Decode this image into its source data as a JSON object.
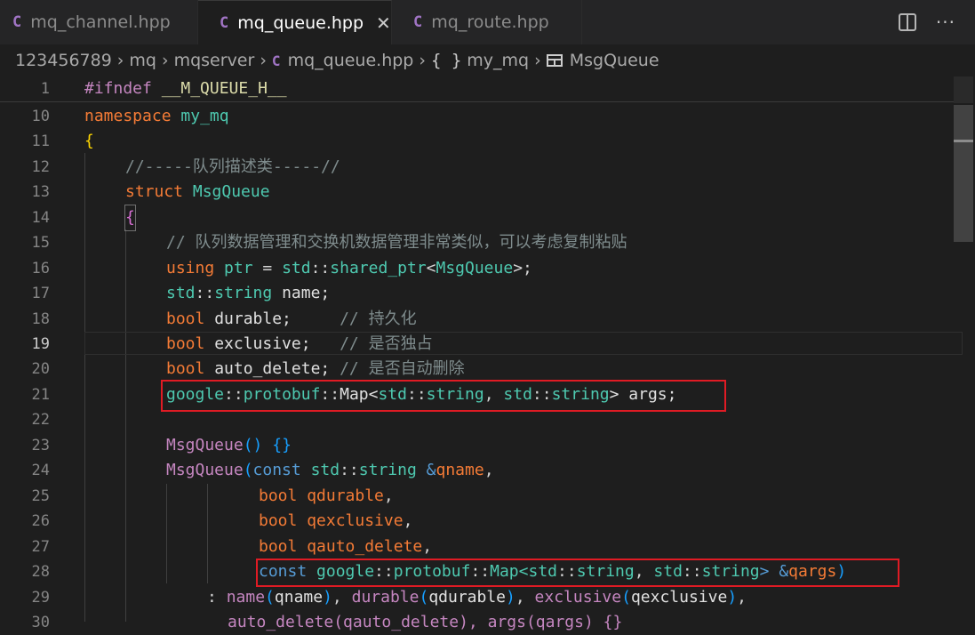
{
  "tabs": [
    {
      "label": "mq_channel.hpp",
      "icon": "C"
    },
    {
      "label": "mq_queue.hpp",
      "icon": "C",
      "close": "✕"
    },
    {
      "label": "mq_route.hpp",
      "icon": "C"
    }
  ],
  "breadcrumb": {
    "items": [
      "123456789",
      "mq",
      "mqserver",
      "mq_queue.hpp",
      "my_mq",
      "MsgQueue"
    ],
    "braces": "{ }",
    "file_icon": "C"
  },
  "editor": {
    "line_numbers": [
      "1",
      "10",
      "11",
      "12",
      "13",
      "14",
      "15",
      "16",
      "17",
      "18",
      "19",
      "20",
      "21",
      "22",
      "23",
      "24",
      "25",
      "26",
      "27",
      "28",
      "29",
      "30"
    ],
    "current_line": "19",
    "lines": {
      "l1_macro": "#ifndef",
      "l1_name": "__M_QUEUE_H__",
      "l10_kw": "namespace",
      "l10_name": "my_mq",
      "l11_brace": "{",
      "l12_comment": "//-----队列描述类-----//",
      "l13_kw": "struct",
      "l13_name": "MsgQueue",
      "l14_brace": "{",
      "l15_comment": "// 队列数据管理和交换机数据管理非常类似，可以考虑复制粘贴",
      "l16_using": "using",
      "l16_ptr": "ptr",
      "l16_eq": " = ",
      "l16_std": "std",
      "l16_sep": "::",
      "l16_shared": "shared_ptr",
      "l16_lt": "<",
      "l16_cls": "MsgQueue",
      "l16_end": ">;",
      "l17_std": "std",
      "l17_sep": "::",
      "l17_type": "string",
      "l17_rest": " name;",
      "l18_bool": "bool",
      "l18_rest": " durable;",
      "l18_comment": "// 持久化",
      "l19_bool": "bool",
      "l19_rest": " exclusive;",
      "l19_comment": "// 是否独占",
      "l20_bool": "bool",
      "l20_rest": " auto_delete;",
      "l20_comment": "// 是否自动删除",
      "l21_google": "google",
      "l21_sep1": "::",
      "l21_protobuf": "protobuf",
      "l21_sep2": "::",
      "l21_map": "Map<",
      "l21_std1": "std",
      "l21_sep3": "::",
      "l21_str1": "string",
      "l21_comma": ", ",
      "l21_std2": "std",
      "l21_sep4": "::",
      "l21_str2": "string",
      "l21_end": "> args;",
      "l23_ctor": "MsgQueue",
      "l23_par": "()",
      "l23_sp": " ",
      "l23_body": "{}",
      "l24_ctor": "MsgQueue",
      "l24_open": "(",
      "l24_const": "const",
      "l24_std": " std",
      "l24_sep": "::",
      "l24_type": "string",
      "l24_amp": " &",
      "l24_param": "qname",
      "l24_comma": ",",
      "l25_bool": "bool",
      "l25_param": " qdurable",
      "l25_comma": ",",
      "l26_bool": "bool",
      "l26_param": " qexclusive",
      "l26_comma": ",",
      "l27_bool": "bool",
      "l27_param": " qauto_delete",
      "l27_comma": ",",
      "l28_const": "const",
      "l28_google": " google",
      "l28_sep1": "::",
      "l28_protobuf": "protobuf",
      "l28_sep2": "::",
      "l28_map": "Map<",
      "l28_std1": "std",
      "l28_sep3": "::",
      "l28_str1": "string",
      "l28_comma": ", ",
      "l28_std2": "std",
      "l28_sep4": "::",
      "l28_str2": "string",
      "l28_gt": "> &",
      "l28_param": "qargs",
      "l28_close": ")",
      "l29_colon": ": ",
      "l29_f1": "name",
      "l29_o1": "(",
      "l29_a1": "qname",
      "l29_c1": ")",
      "l29_s1": ", ",
      "l29_f2": "durable",
      "l29_o2": "(",
      "l29_a2": "qdurable",
      "l29_c2": ")",
      "l29_s2": ", ",
      "l29_f3": "exclusive",
      "l29_o3": "(",
      "l29_a3": "qexclusive",
      "l29_c3": ")",
      "l29_s3": ",",
      "l30_text": "auto_delete(qauto_delete), args(qargs) {}"
    }
  },
  "colors": {
    "highlight_box": "#e01b24",
    "background": "#1e1e1e"
  }
}
